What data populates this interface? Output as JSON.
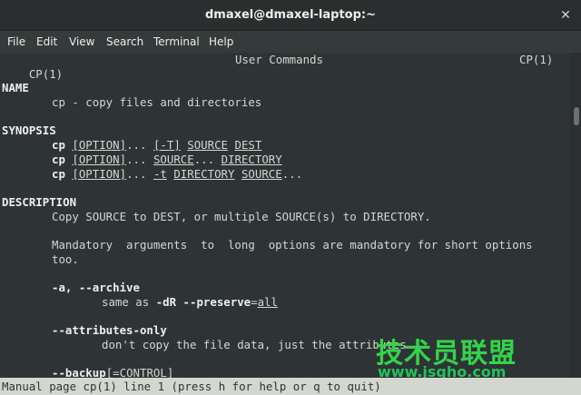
{
  "window": {
    "title": "dmaxel@dmaxel-laptop:~"
  },
  "menu": [
    "File",
    "Edit",
    "View",
    "Search",
    "Terminal",
    "Help"
  ],
  "man": {
    "header_left": "CP(1)",
    "header_center": "User Commands",
    "header_right": "CP(1)",
    "name_heading": "NAME",
    "name_text": "cp - copy files and directories",
    "synopsis_heading": "SYNOPSIS",
    "synopsis": [
      {
        "cmd": "cp",
        "a": "[OPTION]",
        "b": "...",
        "c": "[-T]",
        "d": "SOURCE",
        "e": "DEST",
        "f": ""
      },
      {
        "cmd": "cp",
        "a": "[OPTION]",
        "b": "...",
        "c": "SOURCE",
        "d": "...",
        "e": "DIRECTORY",
        "f": ""
      },
      {
        "cmd": "cp",
        "a": "[OPTION]",
        "b": "...",
        "c": "-t",
        "d": "DIRECTORY",
        "e": "SOURCE",
        "f": "..."
      }
    ],
    "desc_heading": "DESCRIPTION",
    "desc_line1": "Copy SOURCE to DEST, or multiple SOURCE(s) to DIRECTORY.",
    "desc_line2": "Mandatory  arguments  to  long  options are mandatory for short options",
    "desc_line3": "too.",
    "opt1": "-a, --archive",
    "opt1_desc_a": "same as ",
    "opt1_desc_b": "-dR --preserve",
    "opt1_desc_c": "=",
    "opt1_desc_d": "all",
    "opt2": "--attributes-only",
    "opt2_desc": "don't copy the file data, just the attributes",
    "opt3": "--backup",
    "opt3_b": "[=",
    "opt3_c": "CONTROL",
    "opt3_d": "]"
  },
  "status": "Manual page cp(1) line 1 (press h for help or q to quit)",
  "watermark": {
    "cn": "技术员联盟",
    "url": "www.jsgho.com"
  }
}
